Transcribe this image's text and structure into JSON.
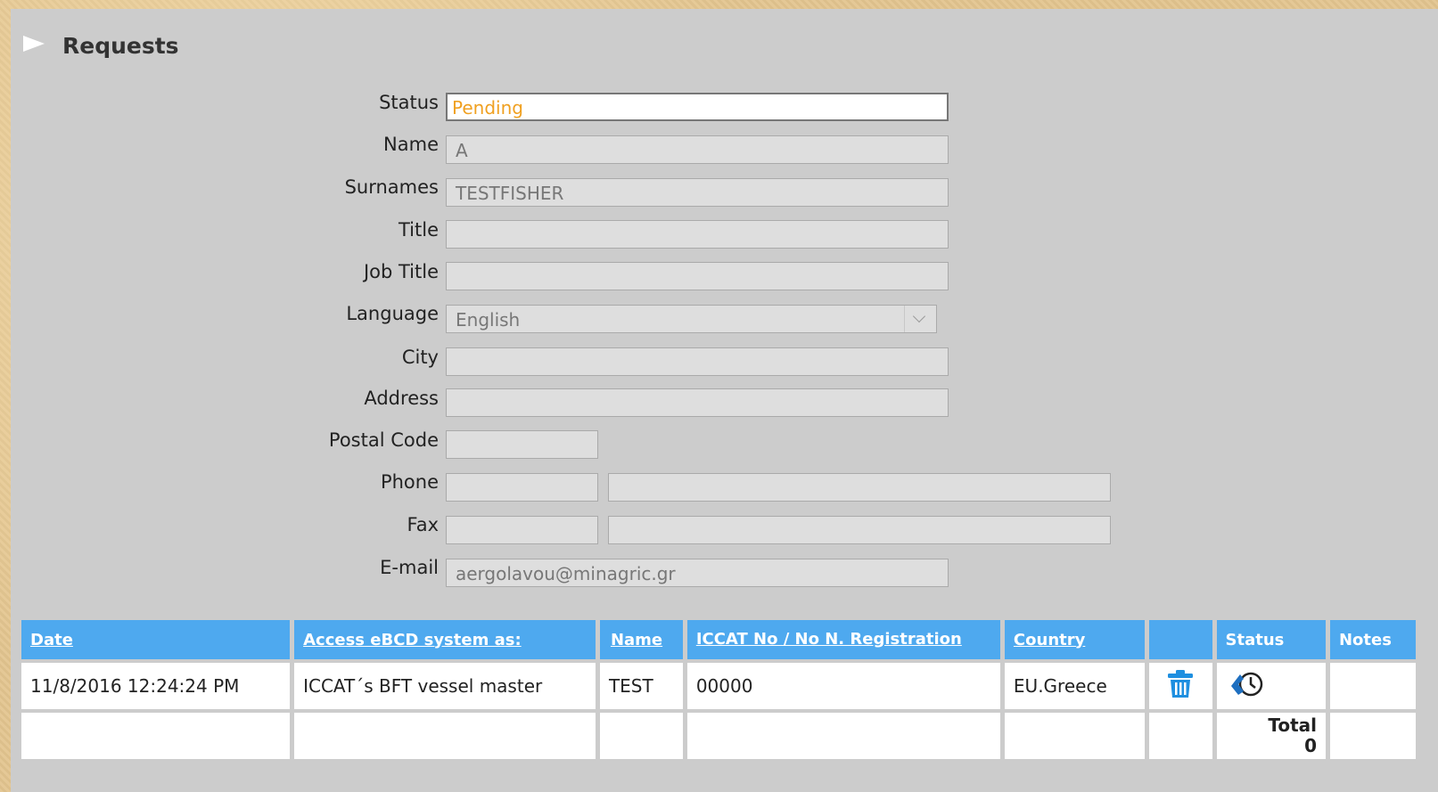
{
  "page": {
    "title": "Requests"
  },
  "form": {
    "status": {
      "label": "Status",
      "value": "Pending"
    },
    "name": {
      "label": "Name",
      "value": "A"
    },
    "surnames": {
      "label": "Surnames",
      "value": "TESTFISHER"
    },
    "title": {
      "label": "Title",
      "value": ""
    },
    "job_title": {
      "label": "Job Title",
      "value": ""
    },
    "language": {
      "label": "Language",
      "value": "English"
    },
    "city": {
      "label": "City",
      "value": ""
    },
    "address": {
      "label": "Address",
      "value": ""
    },
    "postal_code": {
      "label": "Postal Code",
      "value": ""
    },
    "phone": {
      "label": "Phone",
      "prefix": "",
      "value": ""
    },
    "fax": {
      "label": "Fax",
      "prefix": "",
      "value": ""
    },
    "email": {
      "label": "E-mail",
      "value": "aergolavou@minagric.gr"
    }
  },
  "table": {
    "headers": {
      "date": "Date",
      "access": "Access eBCD system as:",
      "name": "Name",
      "iccat": "ICCAT No / No N. Registration",
      "country": "Country",
      "action": "",
      "status": "Status",
      "notes": "Notes"
    },
    "rows": [
      {
        "date": "11/8/2016 12:24:24 PM",
        "access": "ICCAT´s BFT vessel master",
        "name": "TEST",
        "iccat": "00000",
        "country": "EU.Greece",
        "action_icon": "trash-icon",
        "status_icon": "pending-clock-icon",
        "notes": ""
      }
    ],
    "footer": {
      "total_label": "Total",
      "total_value": "0"
    }
  },
  "colors": {
    "header_bg": "#4ea9ef",
    "status_value": "#f0a020",
    "panel_bg": "#cccccc",
    "icon_blue": "#1e8fe0"
  }
}
